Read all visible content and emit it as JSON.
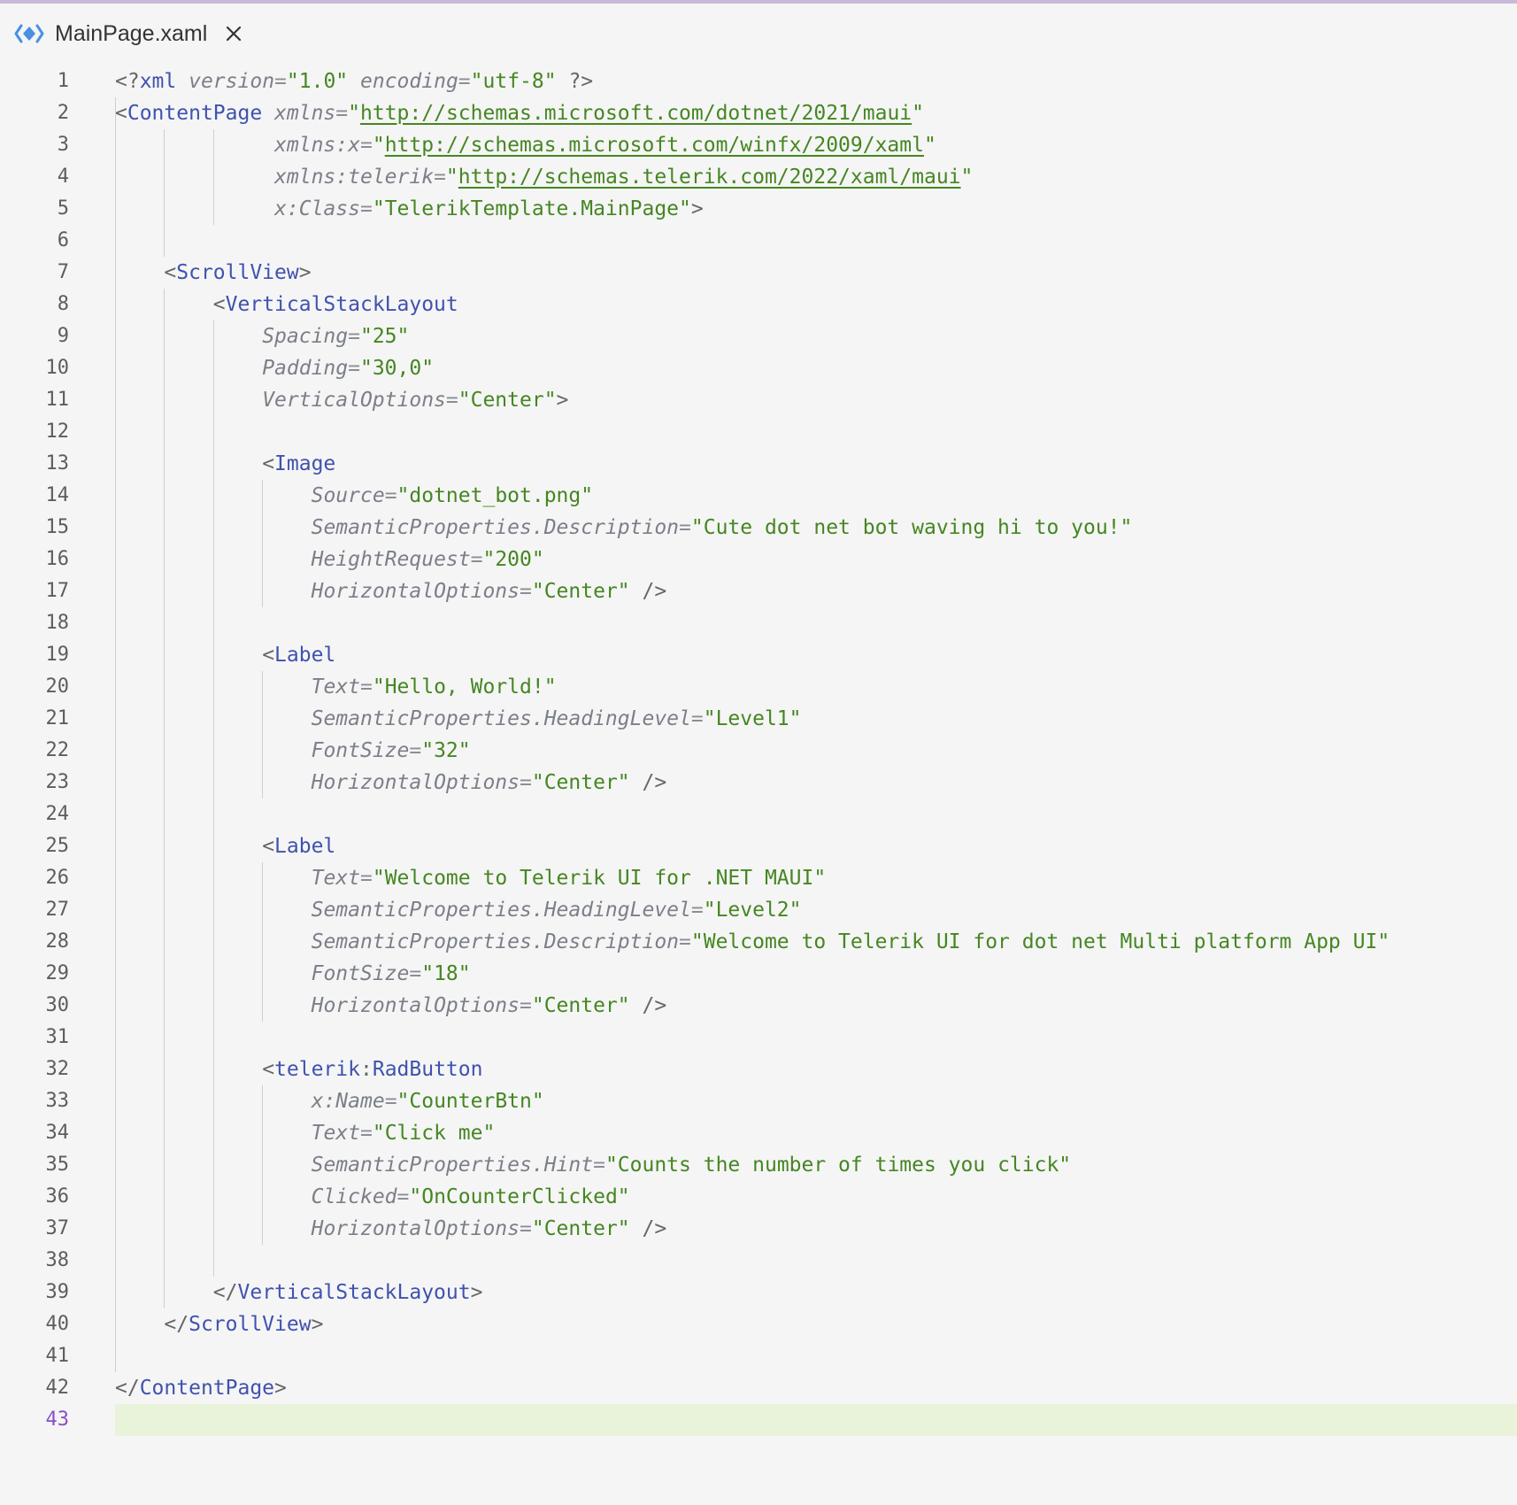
{
  "tab": {
    "title": "MainPage.xaml",
    "icon": "xaml-file-icon",
    "close_icon": "close-icon"
  },
  "editor": {
    "current_line": 43,
    "lines": [
      {
        "n": "1",
        "indent": 0,
        "tokens": [
          [
            "p",
            "<?"
          ],
          [
            "t",
            "xml"
          ],
          [
            "m",
            " "
          ],
          [
            "a",
            "version"
          ],
          [
            "e",
            "="
          ],
          [
            "s",
            "\"1.0\""
          ],
          [
            "m",
            " "
          ],
          [
            "a",
            "encoding"
          ],
          [
            "e",
            "="
          ],
          [
            "s",
            "\"utf-8\""
          ],
          [
            "m",
            " "
          ],
          [
            "p",
            "?>"
          ]
        ]
      },
      {
        "n": "2",
        "indent": 0,
        "tokens": [
          [
            "p",
            "<"
          ],
          [
            "t",
            "ContentPage"
          ],
          [
            "m",
            " "
          ],
          [
            "a",
            "xmlns"
          ],
          [
            "e",
            "="
          ],
          [
            "s",
            "\""
          ],
          [
            "u",
            "http://schemas.microsoft.com/dotnet/2021/maui"
          ],
          [
            "s",
            "\""
          ]
        ]
      },
      {
        "n": "3",
        "indent": 13,
        "tokens": [
          [
            "a",
            "xmlns:x"
          ],
          [
            "e",
            "="
          ],
          [
            "s",
            "\""
          ],
          [
            "u",
            "http://schemas.microsoft.com/winfx/2009/xaml"
          ],
          [
            "s",
            "\""
          ]
        ]
      },
      {
        "n": "4",
        "indent": 13,
        "tokens": [
          [
            "a",
            "xmlns:telerik"
          ],
          [
            "e",
            "="
          ],
          [
            "s",
            "\""
          ],
          [
            "u",
            "http://schemas.telerik.com/2022/xaml/maui"
          ],
          [
            "s",
            "\""
          ]
        ]
      },
      {
        "n": "5",
        "indent": 13,
        "tokens": [
          [
            "a",
            "x:Class"
          ],
          [
            "e",
            "="
          ],
          [
            "s",
            "\"TelerikTemplate.MainPage\""
          ],
          [
            "p",
            ">"
          ]
        ]
      },
      {
        "n": "6",
        "indent": 0,
        "tokens": []
      },
      {
        "n": "7",
        "indent": 4,
        "tokens": [
          [
            "p",
            "<"
          ],
          [
            "t",
            "ScrollView"
          ],
          [
            "p",
            ">"
          ]
        ]
      },
      {
        "n": "8",
        "indent": 8,
        "tokens": [
          [
            "p",
            "<"
          ],
          [
            "t",
            "VerticalStackLayout"
          ]
        ]
      },
      {
        "n": "9",
        "indent": 12,
        "tokens": [
          [
            "a",
            "Spacing"
          ],
          [
            "e",
            "="
          ],
          [
            "s",
            "\"25\""
          ]
        ]
      },
      {
        "n": "10",
        "indent": 12,
        "tokens": [
          [
            "a",
            "Padding"
          ],
          [
            "e",
            "="
          ],
          [
            "s",
            "\"30,0\""
          ]
        ]
      },
      {
        "n": "11",
        "indent": 12,
        "tokens": [
          [
            "a",
            "VerticalOptions"
          ],
          [
            "e",
            "="
          ],
          [
            "s",
            "\"Center\""
          ],
          [
            "p",
            ">"
          ]
        ]
      },
      {
        "n": "12",
        "indent": 0,
        "tokens": []
      },
      {
        "n": "13",
        "indent": 12,
        "tokens": [
          [
            "p",
            "<"
          ],
          [
            "t",
            "Image"
          ]
        ]
      },
      {
        "n": "14",
        "indent": 16,
        "tokens": [
          [
            "a",
            "Source"
          ],
          [
            "e",
            "="
          ],
          [
            "s",
            "\"dotnet_bot.png\""
          ]
        ]
      },
      {
        "n": "15",
        "indent": 16,
        "tokens": [
          [
            "a",
            "SemanticProperties.Description"
          ],
          [
            "e",
            "="
          ],
          [
            "s",
            "\"Cute dot net bot waving hi to you!\""
          ]
        ]
      },
      {
        "n": "16",
        "indent": 16,
        "tokens": [
          [
            "a",
            "HeightRequest"
          ],
          [
            "e",
            "="
          ],
          [
            "s",
            "\"200\""
          ]
        ]
      },
      {
        "n": "17",
        "indent": 16,
        "tokens": [
          [
            "a",
            "HorizontalOptions"
          ],
          [
            "e",
            "="
          ],
          [
            "s",
            "\"Center\""
          ],
          [
            "m",
            " "
          ],
          [
            "p",
            "/>"
          ]
        ]
      },
      {
        "n": "18",
        "indent": 0,
        "tokens": []
      },
      {
        "n": "19",
        "indent": 12,
        "tokens": [
          [
            "p",
            "<"
          ],
          [
            "t",
            "Label"
          ]
        ]
      },
      {
        "n": "20",
        "indent": 16,
        "tokens": [
          [
            "a",
            "Text"
          ],
          [
            "e",
            "="
          ],
          [
            "s",
            "\"Hello, World!\""
          ]
        ]
      },
      {
        "n": "21",
        "indent": 16,
        "tokens": [
          [
            "a",
            "SemanticProperties.HeadingLevel"
          ],
          [
            "e",
            "="
          ],
          [
            "s",
            "\"Level1\""
          ]
        ]
      },
      {
        "n": "22",
        "indent": 16,
        "tokens": [
          [
            "a",
            "FontSize"
          ],
          [
            "e",
            "="
          ],
          [
            "s",
            "\"32\""
          ]
        ]
      },
      {
        "n": "23",
        "indent": 16,
        "tokens": [
          [
            "a",
            "HorizontalOptions"
          ],
          [
            "e",
            "="
          ],
          [
            "s",
            "\"Center\""
          ],
          [
            "m",
            " "
          ],
          [
            "p",
            "/>"
          ]
        ]
      },
      {
        "n": "24",
        "indent": 0,
        "tokens": []
      },
      {
        "n": "25",
        "indent": 12,
        "tokens": [
          [
            "p",
            "<"
          ],
          [
            "t",
            "Label"
          ]
        ]
      },
      {
        "n": "26",
        "indent": 16,
        "tokens": [
          [
            "a",
            "Text"
          ],
          [
            "e",
            "="
          ],
          [
            "s",
            "\"Welcome to Telerik UI for .NET MAUI\""
          ]
        ]
      },
      {
        "n": "27",
        "indent": 16,
        "tokens": [
          [
            "a",
            "SemanticProperties.HeadingLevel"
          ],
          [
            "e",
            "="
          ],
          [
            "s",
            "\"Level2\""
          ]
        ]
      },
      {
        "n": "28",
        "indent": 16,
        "tokens": [
          [
            "a",
            "SemanticProperties.Description"
          ],
          [
            "e",
            "="
          ],
          [
            "s",
            "\"Welcome to Telerik UI for dot net Multi platform App UI\""
          ]
        ]
      },
      {
        "n": "29",
        "indent": 16,
        "tokens": [
          [
            "a",
            "FontSize"
          ],
          [
            "e",
            "="
          ],
          [
            "s",
            "\"18\""
          ]
        ]
      },
      {
        "n": "30",
        "indent": 16,
        "tokens": [
          [
            "a",
            "HorizontalOptions"
          ],
          [
            "e",
            "="
          ],
          [
            "s",
            "\"Center\""
          ],
          [
            "m",
            " "
          ],
          [
            "p",
            "/>"
          ]
        ]
      },
      {
        "n": "31",
        "indent": 0,
        "tokens": []
      },
      {
        "n": "32",
        "indent": 12,
        "tokens": [
          [
            "p",
            "<"
          ],
          [
            "t",
            "telerik"
          ],
          [
            "p",
            ":"
          ],
          [
            "t",
            "RadButton"
          ]
        ]
      },
      {
        "n": "33",
        "indent": 16,
        "tokens": [
          [
            "a",
            "x:Name"
          ],
          [
            "e",
            "="
          ],
          [
            "s",
            "\"CounterBtn\""
          ]
        ]
      },
      {
        "n": "34",
        "indent": 16,
        "tokens": [
          [
            "a",
            "Text"
          ],
          [
            "e",
            "="
          ],
          [
            "s",
            "\"Click me\""
          ]
        ]
      },
      {
        "n": "35",
        "indent": 16,
        "tokens": [
          [
            "a",
            "SemanticProperties.Hint"
          ],
          [
            "e",
            "="
          ],
          [
            "s",
            "\"Counts the number of times you click\""
          ]
        ]
      },
      {
        "n": "36",
        "indent": 16,
        "tokens": [
          [
            "a",
            "Clicked"
          ],
          [
            "e",
            "="
          ],
          [
            "s",
            "\"OnCounterClicked\""
          ]
        ]
      },
      {
        "n": "37",
        "indent": 16,
        "tokens": [
          [
            "a",
            "HorizontalOptions"
          ],
          [
            "e",
            "="
          ],
          [
            "s",
            "\"Center\""
          ],
          [
            "m",
            " "
          ],
          [
            "p",
            "/>"
          ]
        ]
      },
      {
        "n": "38",
        "indent": 0,
        "tokens": []
      },
      {
        "n": "39",
        "indent": 8,
        "tokens": [
          [
            "p",
            "</"
          ],
          [
            "t",
            "VerticalStackLayout"
          ],
          [
            "p",
            ">"
          ]
        ]
      },
      {
        "n": "40",
        "indent": 4,
        "tokens": [
          [
            "p",
            "</"
          ],
          [
            "t",
            "ScrollView"
          ],
          [
            "p",
            ">"
          ]
        ]
      },
      {
        "n": "41",
        "indent": 0,
        "tokens": []
      },
      {
        "n": "42",
        "indent": 0,
        "tokens": [
          [
            "p",
            "</"
          ],
          [
            "t",
            "ContentPage"
          ],
          [
            "p",
            ">"
          ]
        ]
      },
      {
        "n": "43",
        "indent": 0,
        "tokens": []
      }
    ]
  }
}
